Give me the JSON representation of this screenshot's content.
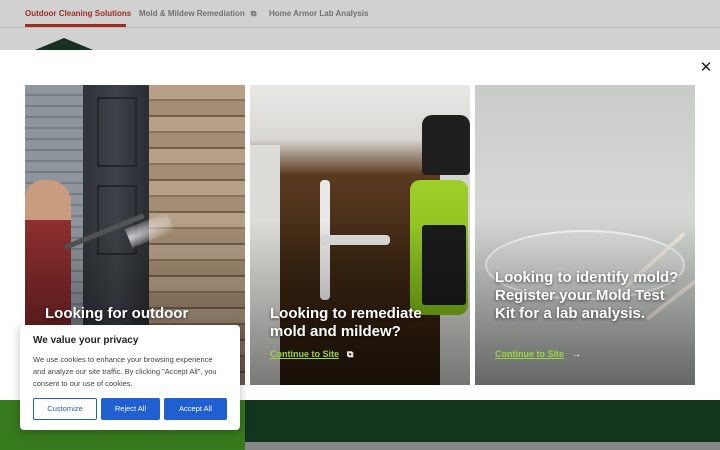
{
  "nav": {
    "tabs": [
      {
        "label": "Outdoor Cleaning Solutions",
        "active": true
      },
      {
        "label": "Mold & Mildew Remediation",
        "external_icon": "external-link-icon"
      },
      {
        "label": "Home Armor Lab Analysis"
      }
    ]
  },
  "modal": {
    "close_label": "✕",
    "cards": [
      {
        "title": "Looking for outdoor"
      },
      {
        "title": "Looking to remediate mold and mildew?",
        "link": "Continue to Site",
        "link_icon": "external-link-icon"
      },
      {
        "title": "Looking to identify mold? Register your Mold Test Kit for a lab analysis.",
        "link": "Continue to Site",
        "link_icon": "arrow-right-icon"
      }
    ]
  },
  "cookie": {
    "title": "We value your privacy",
    "text": "We use cookies to enhance your browsing experience and analyze our site traffic. By clicking \"Accept All\", you consent to our use of cookies.",
    "customize": "Customize",
    "reject": "Reject All",
    "accept": "Accept All"
  },
  "colors": {
    "accent_red": "#c0392b",
    "link_green": "#9bd640",
    "button_blue": "#1f5fcf",
    "band_green": "#3f8a22",
    "band_dark_green": "#153d22"
  }
}
